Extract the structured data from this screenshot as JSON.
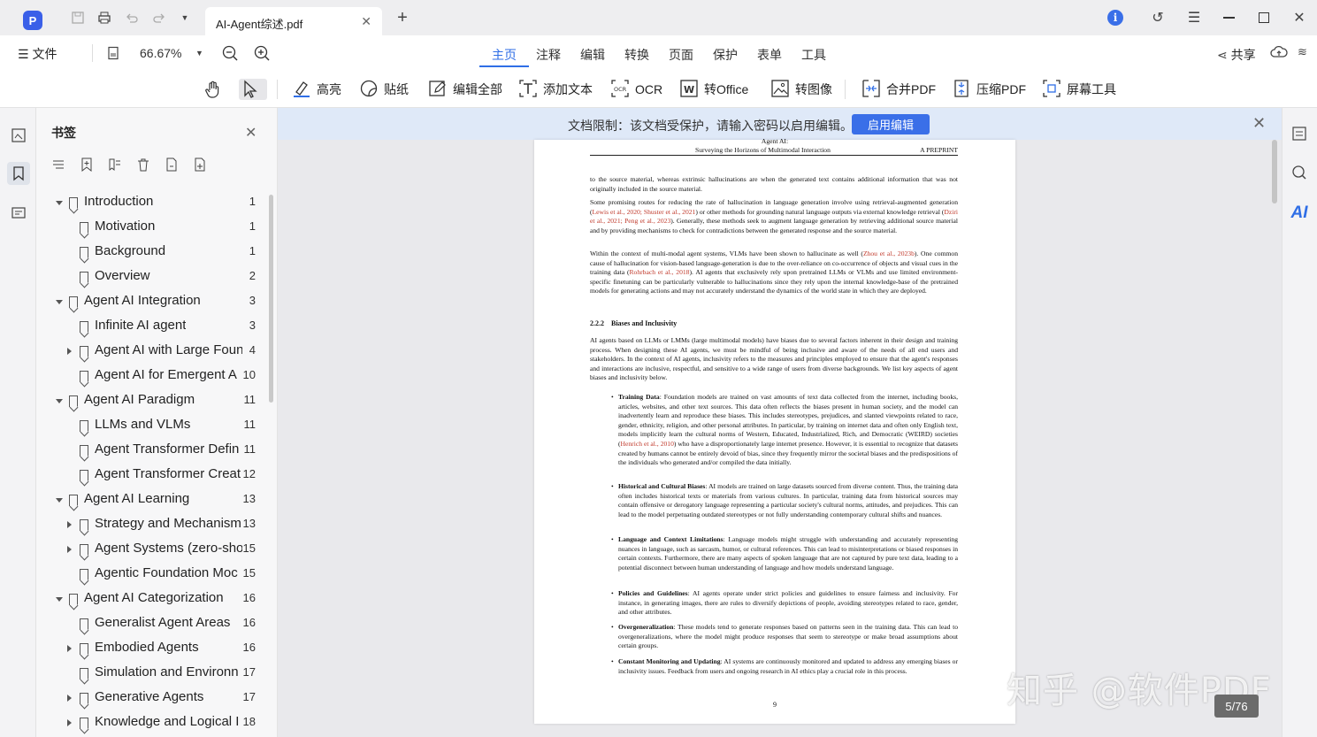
{
  "titlebar": {
    "tab_title": "AI-Agent综述.pdf",
    "new_tab": "+"
  },
  "menubar": {
    "file_label": "文件",
    "zoom": "66.67%",
    "tabs": [
      "主页",
      "注释",
      "编辑",
      "转换",
      "页面",
      "保护",
      "表单",
      "工具"
    ],
    "active_tab": "主页",
    "share_label": "共享"
  },
  "toolbar": {
    "tools": [
      "高亮",
      "贴纸",
      "编辑全部",
      "添加文本",
      "OCR",
      "转Office",
      "转图像",
      "合并PDF",
      "压缩PDF",
      "屏幕工具"
    ]
  },
  "bookmarks": {
    "title": "书签",
    "items": [
      {
        "label": "Introduction",
        "page": "1",
        "level": 0,
        "expand": "down"
      },
      {
        "label": "Motivation",
        "page": "1",
        "level": 1,
        "expand": "none"
      },
      {
        "label": "Background",
        "page": "1",
        "level": 1,
        "expand": "none"
      },
      {
        "label": "Overview",
        "page": "2",
        "level": 1,
        "expand": "none"
      },
      {
        "label": "Agent AI Integration",
        "page": "3",
        "level": 0,
        "expand": "down"
      },
      {
        "label": "Infinite AI agent",
        "page": "3",
        "level": 1,
        "expand": "none"
      },
      {
        "label": "Agent AI with Large Foun",
        "page": "4",
        "level": 1,
        "expand": "right"
      },
      {
        "label": "Agent AI for Emergent A",
        "page": "10",
        "level": 1,
        "expand": "none"
      },
      {
        "label": "Agent AI Paradigm",
        "page": "11",
        "level": 0,
        "expand": "down"
      },
      {
        "label": "LLMs and VLMs",
        "page": "11",
        "level": 1,
        "expand": "none"
      },
      {
        "label": "Agent Transformer Defin",
        "page": "11",
        "level": 1,
        "expand": "none"
      },
      {
        "label": "Agent Transformer Creat",
        "page": "12",
        "level": 1,
        "expand": "none"
      },
      {
        "label": "Agent AI Learning",
        "page": "13",
        "level": 0,
        "expand": "down"
      },
      {
        "label": "Strategy and Mechanism",
        "page": "13",
        "level": 1,
        "expand": "right"
      },
      {
        "label": "Agent Systems (zero-sho",
        "page": "15",
        "level": 1,
        "expand": "right"
      },
      {
        "label": "Agentic Foundation Moc",
        "page": "15",
        "level": 1,
        "expand": "none"
      },
      {
        "label": "Agent AI Categorization",
        "page": "16",
        "level": 0,
        "expand": "down"
      },
      {
        "label": "Generalist Agent Areas",
        "page": "16",
        "level": 1,
        "expand": "none"
      },
      {
        "label": "Embodied Agents",
        "page": "16",
        "level": 1,
        "expand": "right"
      },
      {
        "label": "Simulation and Environn",
        "page": "17",
        "level": 1,
        "expand": "none"
      },
      {
        "label": "Generative Agents",
        "page": "17",
        "level": 1,
        "expand": "right"
      },
      {
        "label": "Knowledge and Logical I",
        "page": "18",
        "level": 1,
        "expand": "right"
      }
    ]
  },
  "notice": {
    "text": "文档限制：该文档受保护，请输入密码以启用编辑。",
    "button": "启用编辑"
  },
  "pdf": {
    "header_top": "Agent AI:",
    "header_title": "Surveying the Horizons of Multimodal Interaction",
    "header_right": "A PREPRINT",
    "p1": "to the source material, whereas extrinsic hallucinations are when the generated text contains additional information that was not originally included in the source material.",
    "p2a": "Some promising routes for reducing the rate of hallucination in language generation involve using retrieval-augmented generation (",
    "p2_ref1": "Lewis et al., 2020; Shuster et al., 2021",
    "p2b": ") or other methods for grounding natural language outputs via external knowledge retrieval (",
    "p2_ref2": "Dziri et al., 2021; Peng et al., 2023",
    "p2c": "). Generally, these methods seek to augment language generation by retrieving additional source material and by providing mechanisms to check for contradictions between the generated response and the source material.",
    "p3a": "Within the context of multi-modal agent systems, VLMs have been shown to hallucinate as well (",
    "p3_ref1": "Zhou et al., 2023b",
    "p3b": "). One common cause of hallucination for vision-based language-generation is due to the over-reliance on co-occurrence of objects and visual cues in the training data (",
    "p3_ref2": "Rohrbach et al., 2018",
    "p3c": "). AI agents that exclusively rely upon pretrained LLMs or VLMs and use limited environment-specific finetuning can be particularly vulnerable to hallucinations since they rely upon the internal knowledge-base of the pretrained models for generating actions and may not accurately understand the dynamics of the world state in which they are deployed.",
    "section": "2.2.2    Biases and Inclusivity",
    "p4": "AI agents based on LLMs or LMMs (large multimodal models) have biases due to several factors inherent in their design and training process. When designing these AI agents, we must be mindful of being inclusive and aware of the needs of all end users and stakeholders. In the context of AI agents, inclusivity refers to the measures and principles employed to ensure that the agent's responses and interactions are inclusive, respectful, and sensitive to a wide range of users from diverse backgrounds. We list key aspects of agent biases and inclusivity below.",
    "b1_head": "Training Data",
    "b1a": ": Foundation models are trained on vast amounts of text data collected from the internet, including books, articles, websites, and other text sources. This data often reflects the biases present in human society, and the model can inadvertently learn and reproduce these biases. This includes stereotypes, prejudices, and slanted viewpoints related to race, gender, ethnicity, religion, and other personal attributes. In particular, by training on internet data and often only English text, models implicitly learn the cultural norms of Western, Educated, Industrialized, Rich, and Democratic (WEIRD) societies (",
    "b1_ref": "Henrich et al., 2010",
    "b1b": ") who have a disproportionately large internet presence. However, it is essential to recognize that datasets created by humans cannot be entirely devoid of bias, since they frequently mirror the societal biases and the predispositions of the individuals who generated and/or compiled the data initially.",
    "b2_head": "Historical and Cultural Biases",
    "b2": ": AI models are trained on large datasets sourced from diverse content. Thus, the training data often includes historical texts or materials from various cultures. In particular, training data from historical sources may contain offensive or derogatory language representing a particular society's cultural norms, attitudes, and prejudices. This can lead to the model perpetuating outdated stereotypes or not fully understanding contemporary cultural shifts and nuances.",
    "b3_head": "Language and Context Limitations",
    "b3": ": Language models might struggle with understanding and accurately representing nuances in language, such as sarcasm, humor, or cultural references. This can lead to misinterpretations or biased responses in certain contexts. Furthermore, there are many aspects of spoken language that are not captured by pure text data, leading to a potential disconnect between human understanding of language and how models understand language.",
    "b4_head": "Policies and Guidelines",
    "b4": ": AI agents operate under strict policies and guidelines to ensure fairness and inclusivity. For instance, in generating images, there are rules to diversify depictions of people, avoiding stereotypes related to race, gender, and other attributes.",
    "b5_head": "Overgeneralization",
    "b5": ": These models tend to generate responses based on patterns seen in the training data. This can lead to overgeneralizations, where the model might produce responses that seem to stereotype or make broad assumptions about certain groups.",
    "b6_head": "Constant Monitoring and Updating",
    "b6": ": AI systems are continuously monitored and updated to address any emerging biases or inclusivity issues. Feedback from users and ongoing research in AI ethics play a crucial role in this process.",
    "page_number": "9"
  },
  "watermark": "知乎 @软件PDF",
  "page_indicator": "5/76",
  "colors": {
    "accent": "#2f6ee6",
    "notice_bg": "#dfe9f8",
    "enable_btn": "#3a6fe8",
    "ref_red": "#c0392b"
  }
}
